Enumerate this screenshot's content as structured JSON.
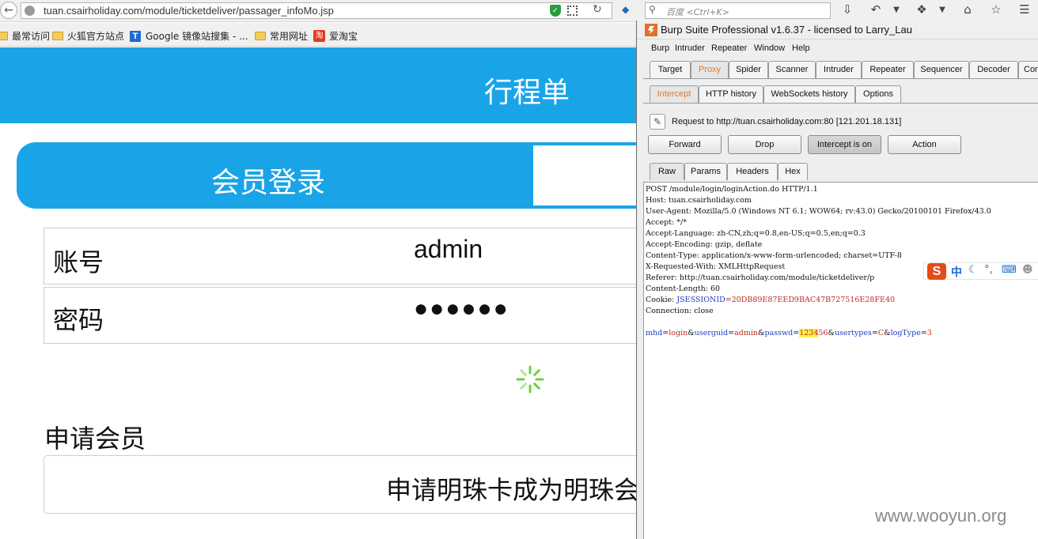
{
  "browser": {
    "url": "tuan.csairholiday.com/module/ticketdeliver/passager_infoMo.jsp",
    "search_placeholder": "百度 <Ctrl+K>",
    "bookmarks": [
      "最常访问",
      "火狐官方站点",
      "Google 镜像站搜集 - ...",
      "常用网址",
      "爱淘宝"
    ]
  },
  "page": {
    "title": "行程单",
    "login_tab": "会员登录",
    "account_label": "账号",
    "account_value": "admin",
    "password_label": "密码",
    "password_value": "●●●●●●",
    "apply_heading": "申请会员",
    "apply_text": "申请明珠卡成为明珠会员"
  },
  "burp": {
    "title": "Burp Suite Professional v1.6.37 - licensed to Larry_Lau",
    "menu": [
      "Burp",
      "Intruder",
      "Repeater",
      "Window",
      "Help"
    ],
    "main_tabs": [
      "Target",
      "Proxy",
      "Spider",
      "Scanner",
      "Intruder",
      "Repeater",
      "Sequencer",
      "Decoder",
      "Cor"
    ],
    "active_main_tab": "Proxy",
    "sub_tabs": [
      "Intercept",
      "HTTP history",
      "WebSockets history",
      "Options"
    ],
    "active_sub_tab": "Intercept",
    "request_info": "Request to http://tuan.csairholiday.com:80  [121.201.18.131]",
    "buttons": [
      "Forward",
      "Drop",
      "Intercept is on",
      "Action"
    ],
    "view_tabs": [
      "Raw",
      "Params",
      "Headers",
      "Hex"
    ],
    "active_view_tab": "Raw",
    "headers": [
      "POST /module/login/loginAction.do HTTP/1.1",
      "Host: tuan.csairholiday.com",
      "User-Agent: Mozilla/5.0 (Windows NT 6.1; WOW64; rv:43.0) Gecko/20100101 Firefox/43.0",
      "Accept: */*",
      "Accept-Language: zh-CN,zh;q=0.8,en-US;q=0.5,en;q=0.3",
      "Accept-Encoding: gzip, deflate",
      "Content-Type: application/x-www-form-urlencoded; charset=UTF-8",
      "X-Requested-With: XMLHttpRequest",
      "Referer: http://tuan.csairholiday.com/module/ticketdeliver/p",
      "Content-Length: 60"
    ],
    "cookie_prefix": "Cookie: ",
    "cookie_name": "JSESSIONID",
    "cookie_value": "=20DB89E87EED9BAC47B727516E28FE40",
    "connection": "Connection: close",
    "body": {
      "p1": "mhd",
      "v1": "login",
      "p2": "userguid",
      "v2": "admin",
      "p3": "passwd",
      "v3_highlight": "1234",
      "v3_rest": "56",
      "p4": "usertypes",
      "v4": "C",
      "p5": "logType",
      "v5": "3"
    }
  },
  "ime": {
    "logo": "S",
    "mode": "中"
  },
  "watermark": "www.wooyun.org"
}
